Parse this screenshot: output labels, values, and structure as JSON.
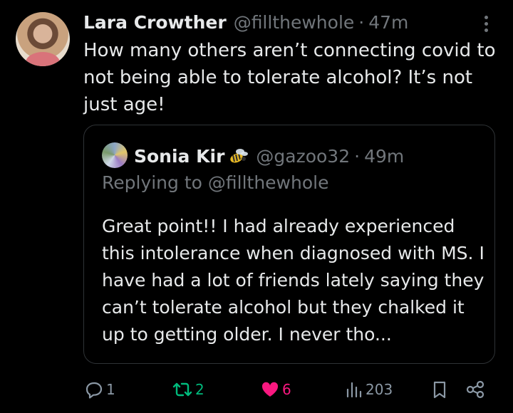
{
  "tweet": {
    "display_name": "Lara Crowther",
    "handle": "@fillthewhole",
    "separator": "·",
    "time": "47m",
    "text": "How many others aren’t connecting covid to not being able to tolerate alcohol? It’s not just age!",
    "avatar": "profile-photo"
  },
  "quoted": {
    "display_name": "Sonia Kir",
    "emoji_icon": "bee-icon",
    "handle": "@gazoo32",
    "separator": "·",
    "time": "49m",
    "replying_to": "Replying to @fillthewhole",
    "text": "Great point!! I had already experienced this intolerance when diagnosed with MS. I have had a lot of friends lately saying they can’t tolerate alcohol but they chalked it up to getting older. I never tho..."
  },
  "actions": {
    "reply_count": "1",
    "repost_count": "2",
    "like_count": "6",
    "views_count": "203"
  },
  "colors": {
    "background": "#000000",
    "text": "#e7e9ea",
    "muted": "#71767b",
    "repost": "#00ba7c",
    "like": "#f91880",
    "border": "#2f3336"
  }
}
